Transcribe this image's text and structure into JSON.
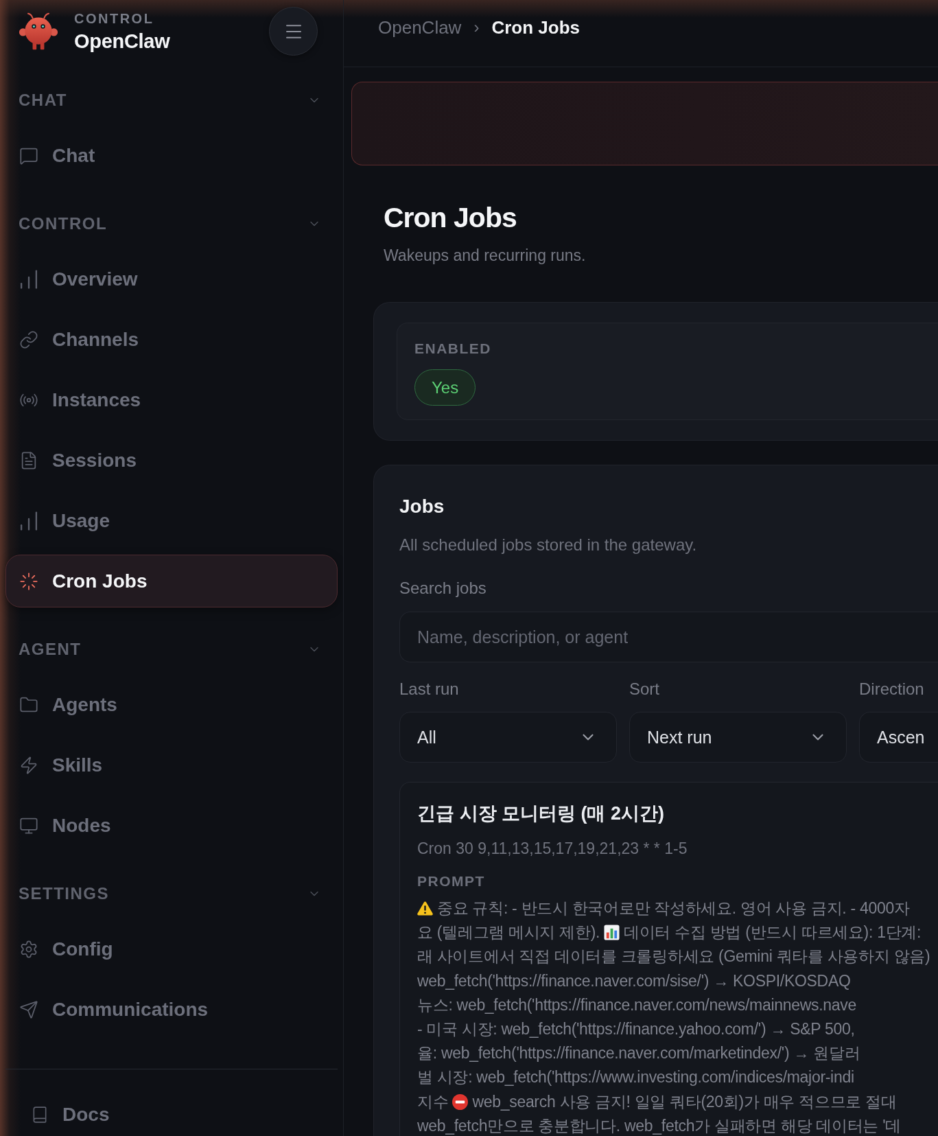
{
  "sidebar": {
    "brand": {
      "caption": "CONTROL",
      "name": "OpenClaw"
    },
    "sections": [
      {
        "title": "CHAT",
        "expanded": true,
        "items": [
          {
            "label": "Chat",
            "selected": false
          }
        ]
      },
      {
        "title": "CONTROL",
        "expanded": true,
        "items": [
          {
            "label": "Overview",
            "selected": false
          },
          {
            "label": "Channels",
            "selected": false
          },
          {
            "label": "Instances",
            "selected": false
          },
          {
            "label": "Sessions",
            "selected": false
          },
          {
            "label": "Usage",
            "selected": false
          },
          {
            "label": "Cron Jobs",
            "selected": true
          }
        ]
      },
      {
        "title": "AGENT",
        "expanded": true,
        "items": [
          {
            "label": "Agents",
            "selected": false
          },
          {
            "label": "Skills",
            "selected": false
          },
          {
            "label": "Nodes",
            "selected": false
          }
        ]
      },
      {
        "title": "SETTINGS",
        "expanded": true,
        "items": [
          {
            "label": "Config",
            "selected": false
          },
          {
            "label": "Communications",
            "selected": false
          }
        ]
      }
    ],
    "footer": {
      "label": "Docs"
    }
  },
  "breadcrumb": {
    "parent": "OpenClaw",
    "separator": "›",
    "current": "Cron Jobs"
  },
  "banner": {
    "kind": "error"
  },
  "page": {
    "title": "Cron Jobs",
    "subtitle": "Wakeups and recurring runs."
  },
  "status": {
    "label": "ENABLED",
    "value": "Yes",
    "on": true
  },
  "jobs": {
    "title": "Jobs",
    "description": "All scheduled jobs stored in the gateway.",
    "search": {
      "label": "Search jobs",
      "placeholder": "Name, description, or agent"
    },
    "filters": [
      {
        "label": "Last run",
        "value": "All"
      },
      {
        "label": "Sort",
        "value": "Next run"
      },
      {
        "label": "Direction",
        "value": "Ascen"
      }
    ],
    "items": [
      {
        "title": "긴급 시장 모니터링 (매 2시간)",
        "schedule": "Cron 30 9,11,13,15,17,19,21,23 * * 1-5",
        "prompt_label": "PROMPT",
        "prompt_lines": [
          [
            {
              "kind": "warning"
            },
            {
              "kind": "text",
              "text": "중요 규칙: - 반드시 한국어로만 작성하세요. 영어 사용 금지. - 4000자"
            }
          ],
          [
            {
              "kind": "text",
              "text": "요 (텔레그램 메시지 제한)."
            },
            {
              "kind": "chart"
            },
            {
              "kind": "text",
              "text": "데이터 수집 방법 (반드시 따르세요): 1단계:"
            }
          ],
          [
            {
              "kind": "text",
              "text": "래 사이트에서 직접 데이터를 크롤링하세요 (Gemini 쿼타를 사용하지 않음)"
            }
          ],
          [
            {
              "kind": "text",
              "text": "web_fetch('https://finance.naver.com/sise/') → KOSPI/KOSDAQ"
            }
          ],
          [
            {
              "kind": "text",
              "text": "뉴스: web_fetch('https://finance.naver.com/news/mainnews.nave"
            }
          ],
          [
            {
              "kind": "text",
              "text": "- 미국 시장: web_fetch('https://finance.yahoo.com/') → S&P 500,"
            }
          ],
          [
            {
              "kind": "text",
              "text": "율: web_fetch('https://finance.naver.com/marketindex/') → 원달러"
            }
          ],
          [
            {
              "kind": "text",
              "text": "벌 시장: web_fetch('https://www.investing.com/indices/major-indi"
            }
          ],
          [
            {
              "kind": "text",
              "text": "지수"
            },
            {
              "kind": "stop"
            },
            {
              "kind": "text",
              "text": "web_search 사용 금지! 일일 쿼타(20회)가 매우 적으므로 절대"
            }
          ],
          [
            {
              "kind": "text",
              "text": "web_fetch만으로 충분합니다. web_fetch가 실패하면 해당 데이터는 '데"
            }
          ]
        ]
      }
    ]
  }
}
